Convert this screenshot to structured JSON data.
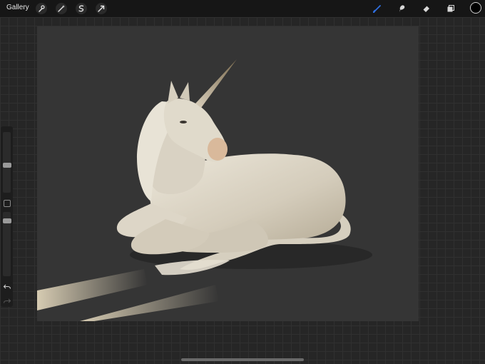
{
  "topbar": {
    "gallery_label": "Gallery",
    "left_tools": [
      "wrench-icon",
      "magic-wand-icon",
      "selection-icon",
      "transform-arrow-icon"
    ],
    "right_tools": [
      "brush-icon",
      "smudge-icon",
      "eraser-icon",
      "layers-icon"
    ],
    "active_tool": "brush-icon",
    "accent_color": "#2f6fe0",
    "current_color": "#000000"
  },
  "sidebar": {
    "brush_size_level": 0.2,
    "opacity_level": 0.2,
    "controls": [
      "brush-size-slider",
      "modify-button",
      "opacity-slider",
      "undo-button",
      "redo-button"
    ]
  },
  "canvas": {
    "content": "artwork-unicorn-lying-down",
    "background_color": "#353535"
  }
}
